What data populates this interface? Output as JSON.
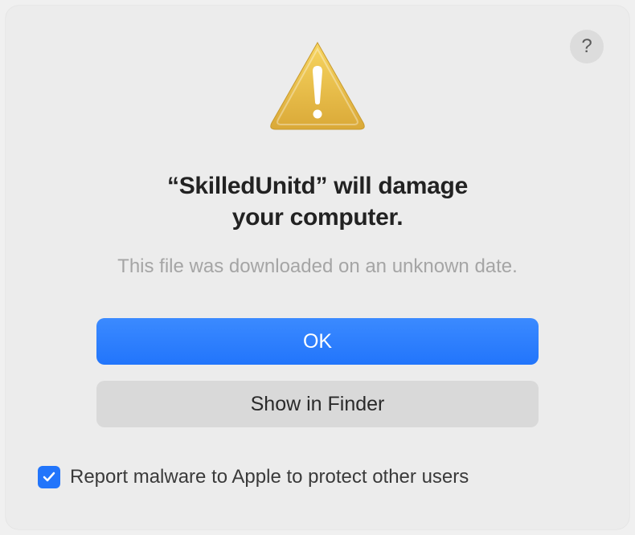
{
  "help": {
    "label": "?"
  },
  "dialog": {
    "title_line1": "“SkilledUnitd” will damage",
    "title_line2": "your computer.",
    "subtitle": "This file was downloaded on an unknown date."
  },
  "buttons": {
    "ok": "OK",
    "show_in_finder": "Show in Finder"
  },
  "checkbox": {
    "checked": true,
    "label": "Report malware to Apple to protect other users"
  },
  "icon": {
    "name": "warning"
  }
}
